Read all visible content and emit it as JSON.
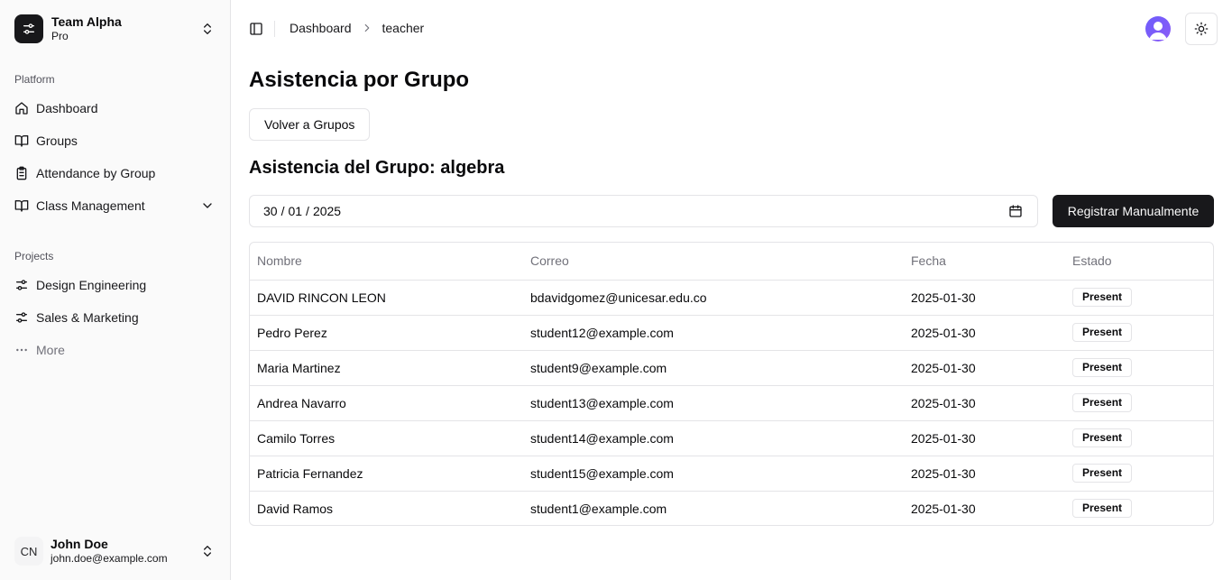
{
  "team": {
    "name": "Team Alpha",
    "plan": "Pro"
  },
  "sidebar": {
    "platform_label": "Platform",
    "platform_items": [
      {
        "label": "Dashboard",
        "icon": "home-icon"
      },
      {
        "label": "Groups",
        "icon": "book-icon"
      },
      {
        "label": "Attendance by Group",
        "icon": "clipboard-icon"
      },
      {
        "label": "Class Management",
        "icon": "book-icon"
      }
    ],
    "projects_label": "Projects",
    "project_items": [
      {
        "label": "Design Engineering",
        "icon": "sliders-icon"
      },
      {
        "label": "Sales & Marketing",
        "icon": "sliders-icon"
      },
      {
        "label": "More",
        "icon": "ellipsis-icon"
      }
    ]
  },
  "user": {
    "initials": "CN",
    "name": "John Doe",
    "email": "john.doe@example.com"
  },
  "breadcrumb": {
    "root": "Dashboard",
    "current": "teacher"
  },
  "main": {
    "title": "Asistencia por Grupo",
    "back_button": "Volver a Grupos",
    "subtitle": "Asistencia del Grupo: algebra",
    "date": {
      "day": "30",
      "month": "01",
      "year": "2025"
    },
    "register_button": "Registrar Manualmente"
  },
  "table": {
    "columns": [
      "Nombre",
      "Correo",
      "Fecha",
      "Estado"
    ],
    "rows": [
      {
        "name": "DAVID RINCON LEON",
        "email": "bdavidgomez@unicesar.edu.co",
        "date": "2025-01-30",
        "status": "Present"
      },
      {
        "name": "Pedro Perez",
        "email": "student12@example.com",
        "date": "2025-01-30",
        "status": "Present"
      },
      {
        "name": "Maria Martinez",
        "email": "student9@example.com",
        "date": "2025-01-30",
        "status": "Present"
      },
      {
        "name": "Andrea Navarro",
        "email": "student13@example.com",
        "date": "2025-01-30",
        "status": "Present"
      },
      {
        "name": "Camilo Torres",
        "email": "student14@example.com",
        "date": "2025-01-30",
        "status": "Present"
      },
      {
        "name": "Patricia Fernandez",
        "email": "student15@example.com",
        "date": "2025-01-30",
        "status": "Present"
      },
      {
        "name": "David Ramos",
        "email": "student1@example.com",
        "date": "2025-01-30",
        "status": "Present"
      }
    ]
  },
  "colors": {
    "primary": "#18181b",
    "border": "#e4e4e7",
    "muted": "#71717a",
    "sidebar_bg": "#fafafa",
    "avatar": "#7c5cfa"
  }
}
